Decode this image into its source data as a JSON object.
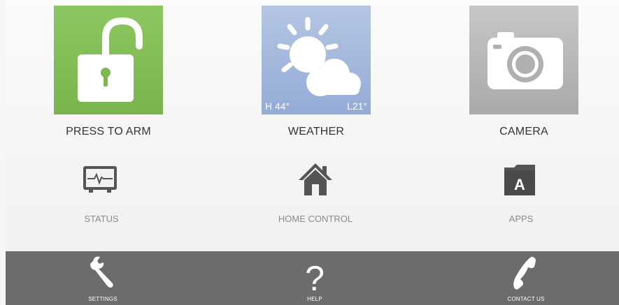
{
  "tiles": {
    "arm": {
      "label": "PRESS TO ARM",
      "icon": "unlocked-padlock-icon",
      "color": "#80bb53"
    },
    "weather": {
      "label": "WEATHER",
      "high": "H 44°",
      "low": "L21°",
      "icon": "sun-cloud-icon",
      "color": "#9fb4da"
    },
    "camera": {
      "label": "CAMERA",
      "icon": "camera-icon",
      "color": "#b6b6b8"
    }
  },
  "secondary": {
    "status": {
      "label": "STATUS",
      "icon": "monitor-heartbeat-icon"
    },
    "home_control": {
      "label": "HOME CONTROL",
      "icon": "house-icon"
    },
    "apps": {
      "label": "APPS",
      "icon": "apps-folder-icon",
      "glyph": "A"
    }
  },
  "bottom_bar": {
    "settings": {
      "label": "SETTINGS",
      "icon": "wrench-icon"
    },
    "help": {
      "label": "HELP",
      "icon": "question-mark-icon",
      "glyph": "?"
    },
    "contact": {
      "label": "CONTACT US",
      "icon": "phone-handset-icon"
    }
  }
}
